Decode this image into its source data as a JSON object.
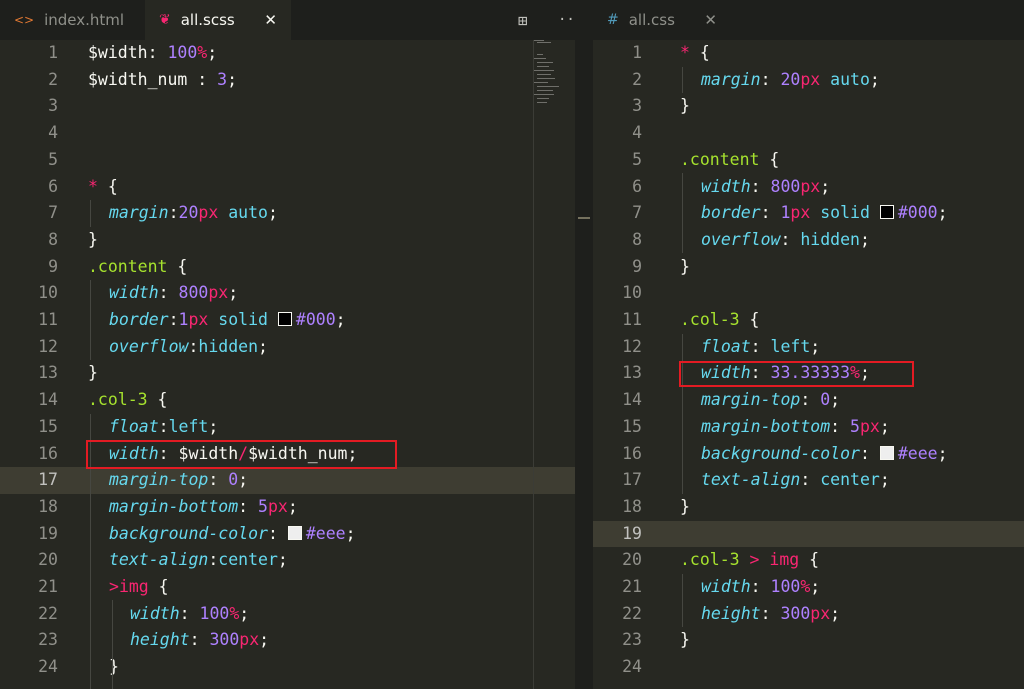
{
  "left_pane": {
    "tabs": [
      {
        "icon": "<>",
        "label": "index.html",
        "active": false
      },
      {
        "icon": "❦",
        "label": "all.scss",
        "active": true,
        "close": "✕"
      }
    ],
    "actions": {
      "split": "⊞",
      "more": "···"
    },
    "current_line": "17",
    "lines": [
      {
        "n": "1",
        "t": [
          "$width",
          ": ",
          "100",
          "%",
          ";"
        ]
      },
      {
        "n": "2",
        "t": [
          "$width_num",
          " : ",
          "3",
          ";"
        ]
      },
      {
        "n": "3",
        "t": []
      },
      {
        "n": "4",
        "t": []
      },
      {
        "n": "5",
        "t": []
      },
      {
        "n": "6",
        "t": [
          "*",
          " {"
        ]
      },
      {
        "n": "7",
        "t": [
          "margin",
          ":",
          "20",
          "px",
          " ",
          "auto",
          ";"
        ]
      },
      {
        "n": "8",
        "t": [
          "}"
        ]
      },
      {
        "n": "9",
        "t": [
          ".content",
          " {"
        ]
      },
      {
        "n": "10",
        "t": [
          "width",
          ": ",
          "800",
          "px",
          ";"
        ]
      },
      {
        "n": "11",
        "t": [
          "border",
          ":",
          "1",
          "px",
          " ",
          "solid",
          " ",
          "#000",
          ";"
        ]
      },
      {
        "n": "12",
        "t": [
          "overflow",
          ":",
          "hidden",
          ";"
        ]
      },
      {
        "n": "13",
        "t": [
          "}"
        ]
      },
      {
        "n": "14",
        "t": [
          ".col-3",
          " {"
        ]
      },
      {
        "n": "15",
        "t": [
          "float",
          ":",
          "left",
          ";"
        ]
      },
      {
        "n": "16",
        "t": [
          "width",
          ": ",
          "$width",
          "/",
          "$width_num",
          ";"
        ]
      },
      {
        "n": "17",
        "t": [
          "margin-top",
          ": ",
          "0",
          ";"
        ]
      },
      {
        "n": "18",
        "t": [
          "margin-bottom",
          ": ",
          "5",
          "px",
          ";"
        ]
      },
      {
        "n": "19",
        "t": [
          "background-color",
          ": ",
          "#eee",
          ";"
        ]
      },
      {
        "n": "20",
        "t": [
          "text-align",
          ":",
          "center",
          ";"
        ]
      },
      {
        "n": "21",
        "t": [
          ">",
          "img",
          " {"
        ]
      },
      {
        "n": "22",
        "t": [
          "width",
          ": ",
          "100",
          "%",
          ";"
        ]
      },
      {
        "n": "23",
        "t": [
          "height",
          ": ",
          "300",
          "px",
          ";"
        ]
      },
      {
        "n": "24",
        "t": [
          "}"
        ]
      }
    ]
  },
  "right_pane": {
    "tabs": [
      {
        "icon": "#",
        "label": "all.css",
        "active": false,
        "close": "✕"
      }
    ],
    "current_line": "19",
    "lines": [
      {
        "n": "1",
        "t": [
          "*",
          " {"
        ]
      },
      {
        "n": "2",
        "t": [
          "margin",
          ": ",
          "20",
          "px",
          " ",
          "auto",
          ";"
        ]
      },
      {
        "n": "3",
        "t": [
          "}"
        ]
      },
      {
        "n": "4",
        "t": []
      },
      {
        "n": "5",
        "t": [
          ".content",
          " {"
        ]
      },
      {
        "n": "6",
        "t": [
          "width",
          ": ",
          "800",
          "px",
          ";"
        ]
      },
      {
        "n": "7",
        "t": [
          "border",
          ": ",
          "1",
          "px",
          " ",
          "solid",
          " ",
          "#000",
          ";"
        ]
      },
      {
        "n": "8",
        "t": [
          "overflow",
          ": ",
          "hidden",
          ";"
        ]
      },
      {
        "n": "9",
        "t": [
          "}"
        ]
      },
      {
        "n": "10",
        "t": []
      },
      {
        "n": "11",
        "t": [
          ".col-3",
          " {"
        ]
      },
      {
        "n": "12",
        "t": [
          "float",
          ": ",
          "left",
          ";"
        ]
      },
      {
        "n": "13",
        "t": [
          "width",
          ": ",
          "33.33333",
          "%",
          ";"
        ]
      },
      {
        "n": "14",
        "t": [
          "margin-top",
          ": ",
          "0",
          ";"
        ]
      },
      {
        "n": "15",
        "t": [
          "margin-bottom",
          ": ",
          "5",
          "px",
          ";"
        ]
      },
      {
        "n": "16",
        "t": [
          "background-color",
          ": ",
          "#eee",
          ";"
        ]
      },
      {
        "n": "17",
        "t": [
          "text-align",
          ": ",
          "center",
          ";"
        ]
      },
      {
        "n": "18",
        "t": [
          "}"
        ]
      },
      {
        "n": "19",
        "t": []
      },
      {
        "n": "20",
        "t": [
          ".col-3",
          " > ",
          "img",
          " {"
        ]
      },
      {
        "n": "21",
        "t": [
          "width",
          ": ",
          "100",
          "%",
          ";"
        ]
      },
      {
        "n": "22",
        "t": [
          "height",
          ": ",
          "300",
          "px",
          ";"
        ]
      },
      {
        "n": "23",
        "t": [
          "}"
        ]
      },
      {
        "n": "24",
        "t": []
      }
    ]
  },
  "colors": {
    "editor_bg": "#272822",
    "highlight_box": "#e31b23",
    "swatch_black": "#000000",
    "swatch_light": "#eeeeee"
  }
}
